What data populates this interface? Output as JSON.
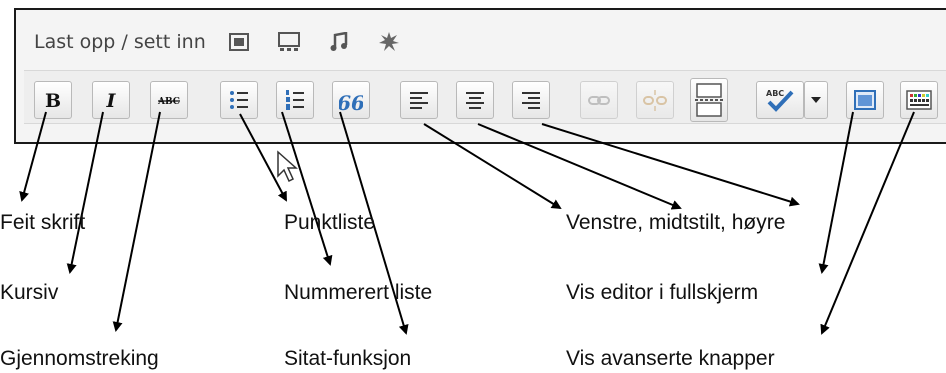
{
  "toolbar": {
    "upload_label": "Last opp / sett inn",
    "upload_icons": [
      "image-icon",
      "gallery-icon",
      "audio-icon",
      "media-icon"
    ],
    "buttons": [
      {
        "name": "bold-button",
        "icon": "bold-icon",
        "text": "B"
      },
      {
        "name": "italic-button",
        "icon": "italic-icon",
        "text": "I"
      },
      {
        "name": "strikethrough-button",
        "icon": "strikethrough-icon",
        "text": "ABC"
      },
      {
        "name": "bullet-list-button",
        "icon": "bullet-list-icon"
      },
      {
        "name": "numbered-list-button",
        "icon": "numbered-list-icon"
      },
      {
        "name": "blockquote-button",
        "icon": "blockquote-icon",
        "text": "66"
      },
      {
        "name": "align-left-button",
        "icon": "align-left-icon"
      },
      {
        "name": "align-center-button",
        "icon": "align-center-icon"
      },
      {
        "name": "align-right-button",
        "icon": "align-right-icon"
      },
      {
        "name": "insert-link-button",
        "icon": "link-icon",
        "disabled": true
      },
      {
        "name": "remove-link-button",
        "icon": "unlink-icon",
        "disabled": true
      },
      {
        "name": "insert-more-button",
        "icon": "page-break-icon"
      },
      {
        "name": "spellcheck-button",
        "icon": "spellcheck-icon",
        "text": "ABC"
      },
      {
        "name": "spellcheck-dropdown-button",
        "icon": "chevron-down-icon"
      },
      {
        "name": "fullscreen-button",
        "icon": "fullscreen-icon"
      },
      {
        "name": "kitchen-sink-button",
        "icon": "kitchen-sink-icon"
      }
    ]
  },
  "annotations": {
    "bold": "Feit skrift",
    "italic": "Kursiv",
    "strikethrough": "Gjennomstreking",
    "bullet_list": "Punktliste",
    "numbered_list": "Nummerert liste",
    "blockquote": "Sitat-funksjon",
    "alignment": "Venstre, midtstilt, høyre",
    "fullscreen": "Vis editor i fullskjerm",
    "advanced": "Vis avanserte knapper"
  },
  "colors": {
    "frame": "#1a1a1a",
    "toolbar_bg": "#eeeeee",
    "icon_blue": "#2f6fb8",
    "icon_dark": "#222222",
    "arrow": "#000000"
  }
}
